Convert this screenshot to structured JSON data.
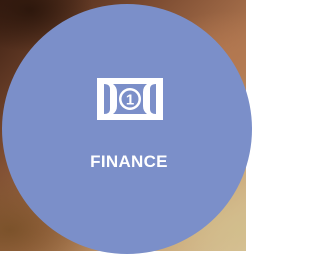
{
  "tile": {
    "label": "FINANCE",
    "icon": "money-bill-icon",
    "icon_digit": "1",
    "color": "#7b8fc9"
  }
}
